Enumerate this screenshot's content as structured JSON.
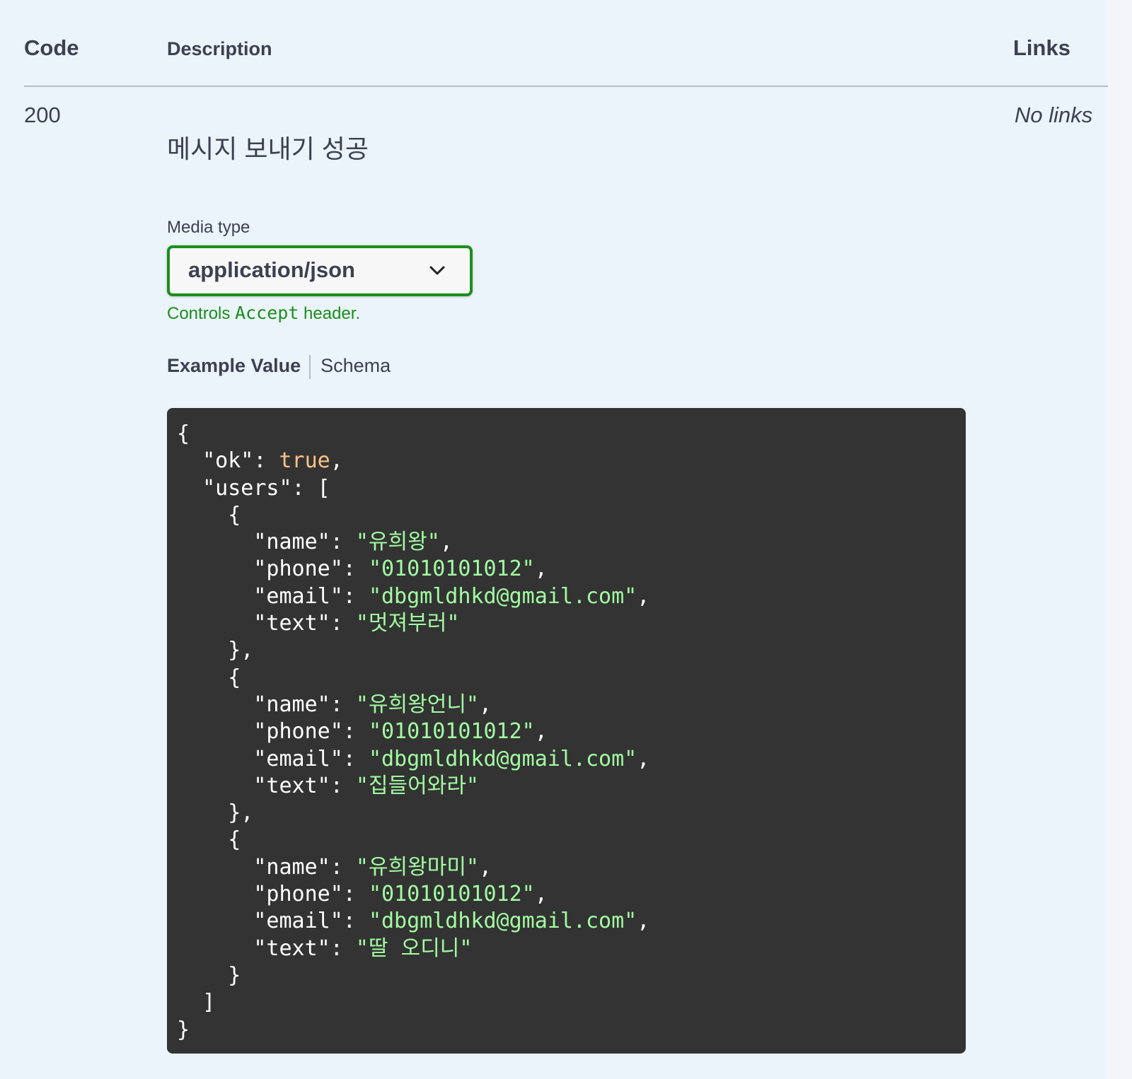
{
  "table": {
    "headers": {
      "code": "Code",
      "description": "Description",
      "links": "Links"
    }
  },
  "response": {
    "code": "200",
    "description": "메시지 보내기 성공",
    "links": "No links",
    "media_type": {
      "label": "Media type",
      "selected": "application/json",
      "note_prefix": "Controls",
      "note_code": "Accept",
      "note_suffix": "header."
    },
    "tabs": {
      "example_value": "Example Value",
      "schema": "Schema"
    },
    "example": {
      "ok": "true",
      "users": [
        {
          "name": "유희왕",
          "phone": "01010101012",
          "email": "dbgmldhkd@gmail.com",
          "text": "멋져부러"
        },
        {
          "name": "유희왕언니",
          "phone": "01010101012",
          "email": "dbgmldhkd@gmail.com",
          "text": "집들어와라"
        },
        {
          "name": "유희왕마미",
          "phone": "01010101012",
          "email": "dbgmldhkd@gmail.com",
          "text": "딸 오디니"
        }
      ]
    }
  },
  "colors": {
    "background": "#ebf3fb",
    "text": "#3b4151",
    "accent_green": "#1a8f1a",
    "code_bg": "#333333",
    "code_bool": "#fcc28c",
    "code_string": "#a2fca2"
  },
  "icons": {
    "select_chevron": "chevron-down-icon"
  }
}
